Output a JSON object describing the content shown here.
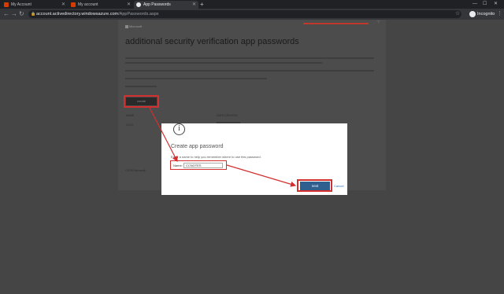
{
  "browser": {
    "tabs": [
      {
        "title": "My Account"
      },
      {
        "title": "My account"
      },
      {
        "title": "App Passwords"
      }
    ],
    "url_host": "account.activedirectory.windowsazure.com",
    "url_path": "/AppPasswords.aspx",
    "profile_label": "Incognito"
  },
  "page": {
    "brand": "Microsoft",
    "title": "additional security verification   app passwords",
    "create_button": "create",
    "col_name": "NAME",
    "col_date": "DATE CREATED",
    "row_name": "CCLD",
    "footer": "©2020 Microsoft"
  },
  "dialog": {
    "icon": "info-icon",
    "title": "Create app password",
    "help": "Enter a name to help you remember where to use this password.",
    "name_label": "Name:",
    "name_value": "CCNOTES",
    "next_label": "next",
    "cancel_label": "Cancel"
  },
  "colors": {
    "highlight": "#d32f2f",
    "primary_button": "#2f5f8f"
  }
}
